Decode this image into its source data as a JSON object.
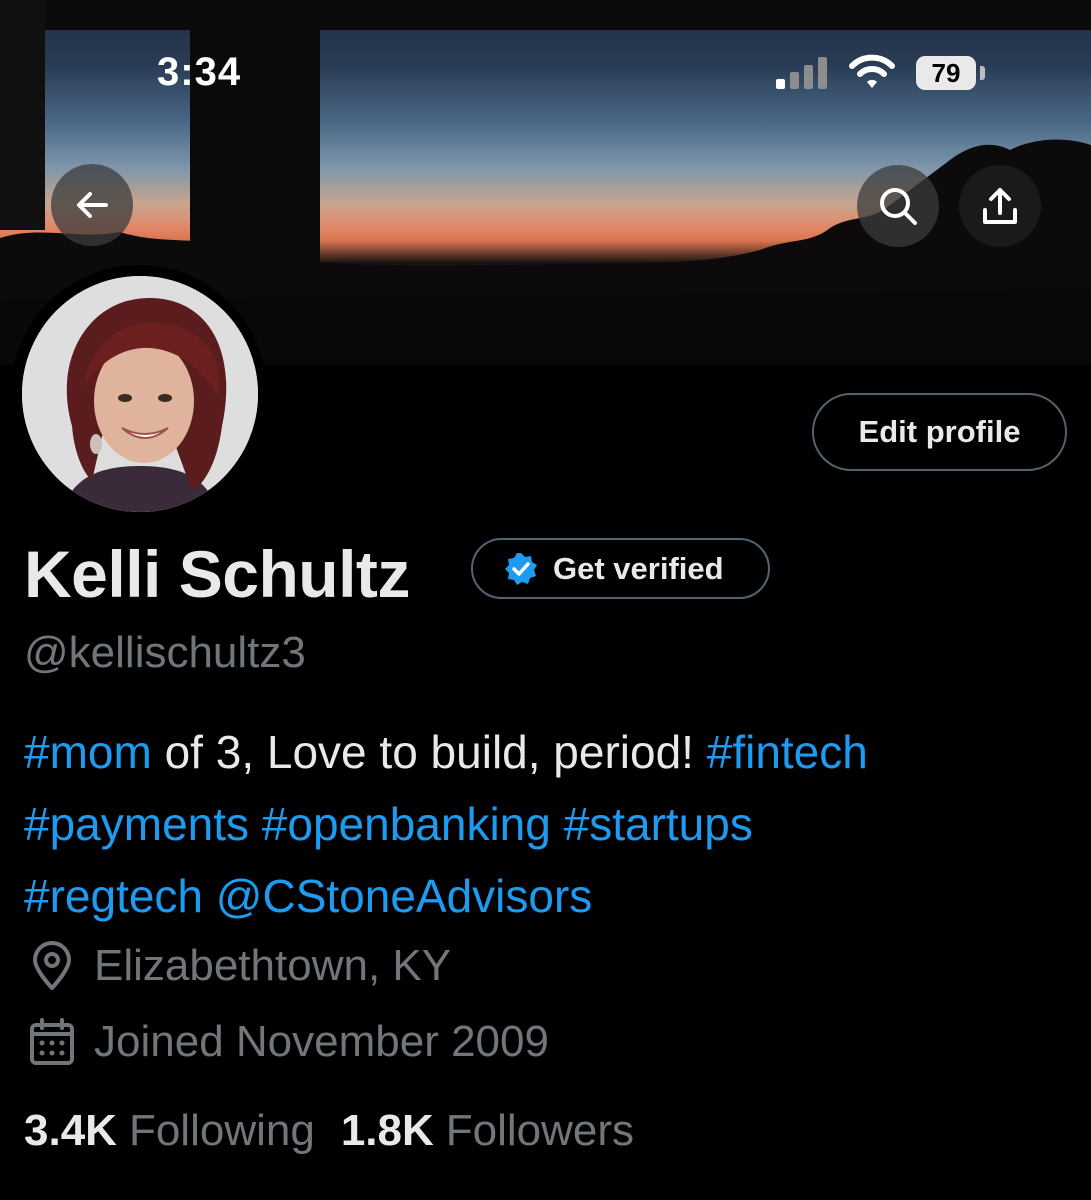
{
  "status_bar": {
    "time": "3:34",
    "battery": "79"
  },
  "profile": {
    "display_name": "Kelli Schultz",
    "get_verified_label": "Get verified",
    "handle": "@kellischultz3",
    "edit_profile_label": "Edit profile",
    "bio": {
      "line1_tag1": "#mom",
      "line1_text": " of 3, Love to build, period! ",
      "line1_tag2": "#fintech",
      "line2": "#payments #openbanking #startups",
      "line3": "#regtech @CStoneAdvisors"
    },
    "location": "Elizabethtown, KY",
    "joined": "Joined November 2009",
    "following_count": "3.4K",
    "following_label": "Following",
    "followers_count": "1.8K",
    "followers_label": "Followers"
  },
  "icons": {
    "back": "arrow-left-icon",
    "search": "search-icon",
    "share": "share-icon",
    "verified": "verified-badge-icon",
    "location": "location-pin-icon",
    "calendar": "calendar-icon"
  },
  "colors": {
    "background": "#000000",
    "primary_text": "#e7e9ea",
    "secondary_text": "#71767b",
    "link": "#1d9bf0",
    "border": "#536471"
  }
}
